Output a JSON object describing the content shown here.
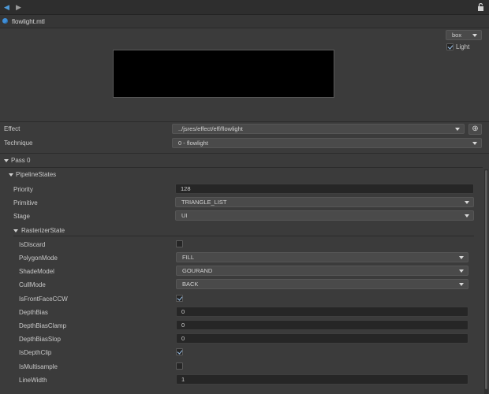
{
  "file": {
    "name": "flowlight.mtl"
  },
  "preview": {
    "shape_selected": "box",
    "light_label": "Light",
    "light_checked": true
  },
  "effect": {
    "label": "Effect",
    "value": "../jsres/effect/eff/flowlight"
  },
  "technique": {
    "label": "Technique",
    "value": "0 - flowlight"
  },
  "pass": {
    "label": "Pass 0"
  },
  "pipeline": {
    "label": "PipelineStates",
    "priority": {
      "label": "Priority",
      "value": "128"
    },
    "primitive": {
      "label": "Primitive",
      "value": "TRIANGLE_LIST"
    },
    "stage": {
      "label": "Stage",
      "value": "UI"
    }
  },
  "rasterizer": {
    "label": "RasterizerState",
    "is_discard": {
      "label": "IsDiscard",
      "checked": false
    },
    "polygon_mode": {
      "label": "PolygonMode",
      "value": "FILL"
    },
    "shade_model": {
      "label": "ShadeModel",
      "value": "GOURAND"
    },
    "cull_mode": {
      "label": "CullMode",
      "value": "BACK"
    },
    "is_front_face_ccw": {
      "label": "IsFrontFaceCCW",
      "checked": true
    },
    "depth_bias": {
      "label": "DepthBias",
      "value": "0"
    },
    "depth_bias_clamp": {
      "label": "DepthBiasClamp",
      "value": "0"
    },
    "depth_bias_slop": {
      "label": "DepthBiasSlop",
      "value": "0"
    },
    "is_depth_clip": {
      "label": "IsDepthClip",
      "checked": true
    },
    "is_multisample": {
      "label": "IsMultisample",
      "checked": false
    },
    "line_width": {
      "label": "LineWidth",
      "value": "1"
    }
  },
  "colors": {
    "accent": "#4e9ad8",
    "background": "#3b3b3b",
    "input_bg": "#262626",
    "select_bg": "#4a4a4a"
  }
}
